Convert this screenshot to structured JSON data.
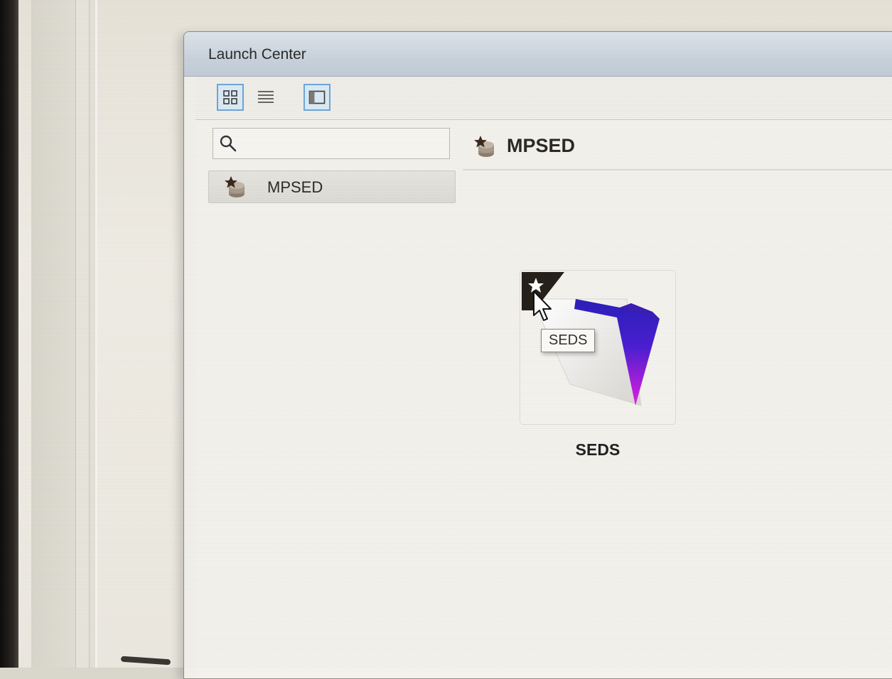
{
  "window": {
    "title": "Launch Center"
  },
  "toolbar": {
    "grid_view_active": true,
    "sidebar_toggle_active": true
  },
  "search": {
    "value": "",
    "placeholder": ""
  },
  "sidebar": {
    "items": [
      {
        "label": "MPSED",
        "icon": "database-star-icon",
        "selected": true
      }
    ]
  },
  "main": {
    "heading": "MPSED",
    "heading_icon": "database-star-icon",
    "apps": [
      {
        "name": "SEDS",
        "tooltip": "SEDS",
        "favorite": true,
        "icon": "filemaker-file-icon"
      }
    ]
  },
  "colors": {
    "titlebar": "#c9d2dc",
    "active_button_border": "#6da6d8",
    "icon_gradient_top": "#2a1fb8",
    "icon_gradient_bottom": "#e21fe0"
  }
}
